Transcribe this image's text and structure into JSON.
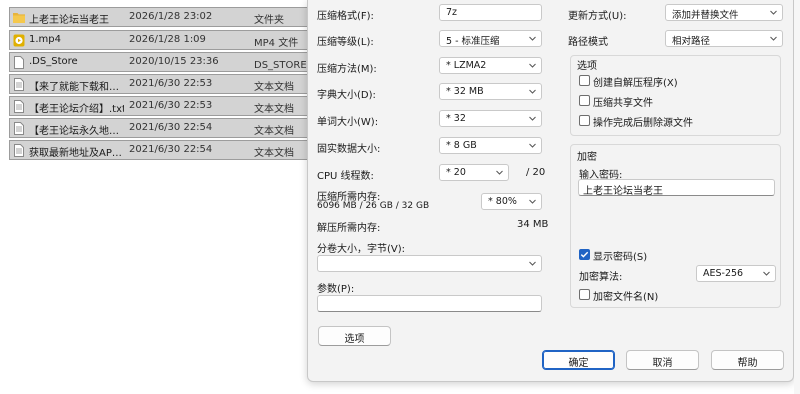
{
  "files": [
    {
      "name": "上老王论坛当老王",
      "date": "2026/1/28 23:02",
      "type": "文件夹",
      "icon": "folder-icon"
    },
    {
      "name": "1.mp4",
      "date": "2026/1/28 1:09",
      "type": "MP4 文件",
      "icon": "media-file-icon"
    },
    {
      "name": ".DS_Store",
      "date": "2020/10/15 23:36",
      "type": "DS_STORE 文件",
      "icon": "blank-file-icon"
    },
    {
      "name": "【来了就能下载和…",
      "date": "2021/6/30 22:53",
      "type": "文本文档",
      "icon": "text-file-icon"
    },
    {
      "name": "【老王论坛介绍】.txt",
      "date": "2021/6/30 22:53",
      "type": "文本文档",
      "icon": "text-file-icon"
    },
    {
      "name": "【老王论坛永久地…",
      "date": "2021/6/30 22:54",
      "type": "文本文档",
      "icon": "text-file-icon"
    },
    {
      "name": "获取最新地址及AP…",
      "date": "2021/6/30 22:54",
      "type": "文本文档",
      "icon": "text-file-icon"
    }
  ],
  "left": {
    "format_label": "压缩格式(F):",
    "format_value": "7z",
    "level_label": "压缩等级(L):",
    "level_value": "5 - 标准压缩",
    "method_label": "压缩方法(M):",
    "method_value": "* LZMA2",
    "dict_label": "字典大小(D):",
    "dict_value": "* 32 MB",
    "word_label": "单词大小(W):",
    "word_value": "* 32",
    "solid_label": "固实数据大小:",
    "solid_value": "* 8 GB",
    "cpu_label": "CPU 线程数:",
    "cpu_value": "* 20",
    "cpu_total": "/ 20",
    "mem_comp_label": "压缩所需内存:",
    "mem_comp_detail": "6096 MB / 26 GB / 32 GB",
    "mem_pct": "* 80%",
    "mem_decomp_label": "解压所需内存:",
    "mem_decomp_value": "34 MB",
    "split_label": "分卷大小，字节(V):",
    "split_value": "",
    "params_label": "参数(P):",
    "params_value": "",
    "options_button": "选项"
  },
  "right": {
    "update_label": "更新方式(U):",
    "update_value": "添加并替换文件",
    "path_label": "路径模式",
    "path_value": "相对路径",
    "options_title": "选项",
    "opt_sfx": "创建自解压程序(X)",
    "opt_shared": "压缩共享文件",
    "opt_delete": "操作完成后删除源文件",
    "enc_title": "加密",
    "pwd_label": "输入密码:",
    "pwd_value": "上老王论坛当老王",
    "show_pwd": "显示密码(S)",
    "enc_method_label": "加密算法:",
    "enc_method_value": "AES-256",
    "enc_names": "加密文件名(N)"
  },
  "buttons": {
    "ok": "确定",
    "cancel": "取消",
    "help": "帮助"
  },
  "colors": {
    "accent": "#1f63c4",
    "selection": "#d3d3d3",
    "folder": "#e8b43a",
    "media": "#e0b000"
  }
}
